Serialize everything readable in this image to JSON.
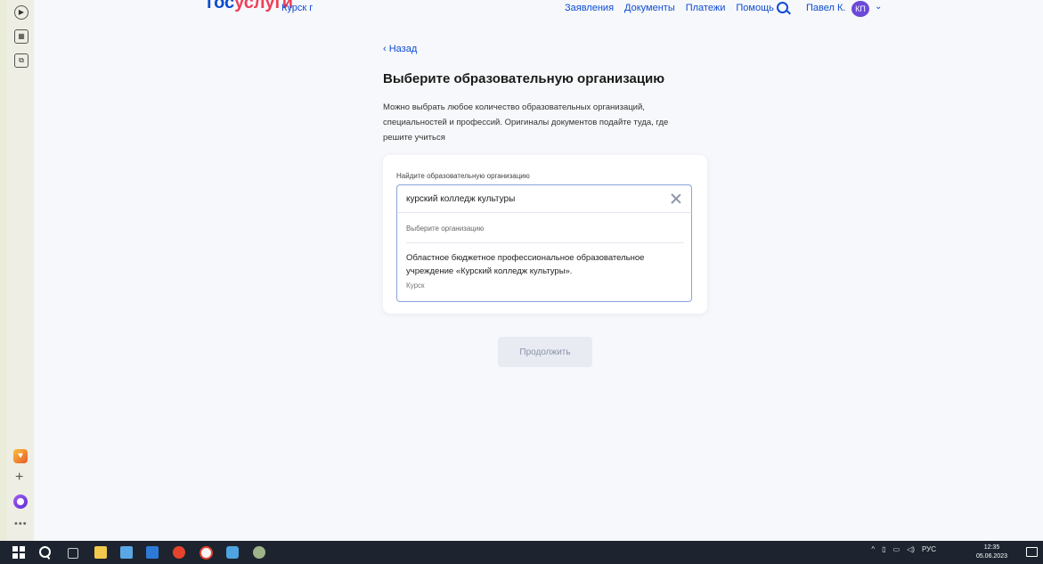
{
  "header": {
    "logo_part1": "гос",
    "logo_part2": "услуги",
    "region": "Курск г",
    "nav": [
      "Заявления",
      "Документы",
      "Платежи",
      "Помощь"
    ],
    "user_name": "Павел К.",
    "avatar_initials": "КП"
  },
  "main": {
    "back_label": "‹ Назад",
    "title": "Выберите образовательную организацию",
    "description": "Можно выбрать любое количество образовательных организаций, специальностей и профессий. Оригиналы документов подайте туда, где решите учиться",
    "field_label": "Найдите образовательную организацию",
    "search_value": "курский колледж культуры",
    "dropdown_hint": "Выберите организацию",
    "option_name": "Областное бюджетное профессиональное образовательное учреждение «Курский колледж культуры».",
    "option_city": "Курск",
    "continue_label": "Продолжить"
  },
  "taskbar": {
    "lang": "РУС",
    "time": "12:35",
    "date": "05.06.2023"
  },
  "colors": {
    "brand_blue": "#0d4cd3",
    "brand_red": "#ee3f58",
    "avatar": "#6b48d8",
    "taskbar": "#1d2430"
  }
}
